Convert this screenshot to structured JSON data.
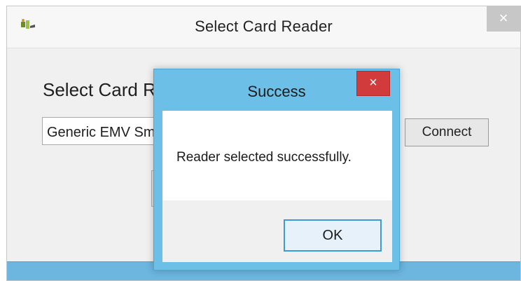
{
  "main_window": {
    "title": "Select Card Reader",
    "close_glyph": "×",
    "app_icon": "card-reader-app-icon",
    "section_label": "Select Card Reader",
    "reader_field_value": "Generic EMV Smartcard Reader",
    "connect_label": "Connect"
  },
  "dialog": {
    "title": "Success",
    "close_glyph": "×",
    "message": "Reader selected successfully.",
    "ok_label": "OK"
  },
  "colors": {
    "accent": "#6cc0e8",
    "close_red": "#d23b3b",
    "ok_border": "#3c9ad6"
  }
}
